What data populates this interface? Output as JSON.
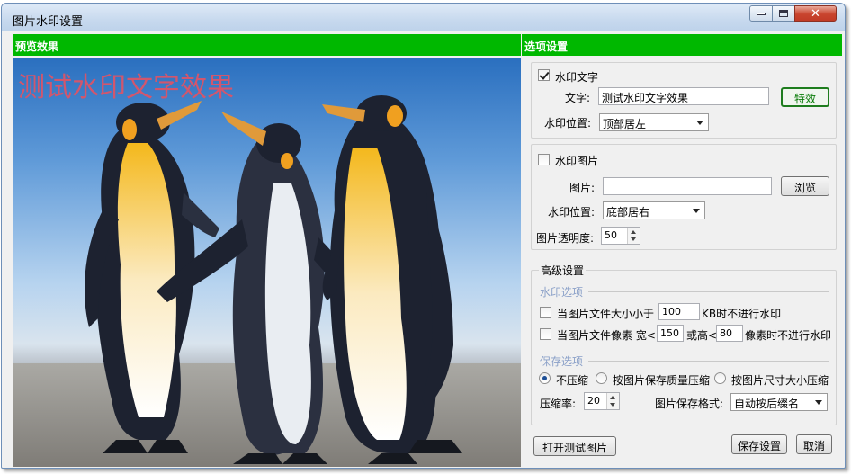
{
  "window": {
    "title": "图片水印设置"
  },
  "preview": {
    "header": "预览效果",
    "watermark_text": "测试水印文字效果"
  },
  "options": {
    "header": "选项设置",
    "text_watermark": {
      "enable_label": "水印文字",
      "checked": true,
      "text_label": "文字:",
      "text_value": "测试水印文字效果",
      "effects_button": "特效",
      "position_label": "水印位置:",
      "position_value": "顶部居左"
    },
    "image_watermark": {
      "enable_label": "水印图片",
      "checked": false,
      "image_label": "图片:",
      "image_value": "",
      "browse_button": "浏览",
      "position_label": "水印位置:",
      "position_value": "底部居右",
      "opacity_label": "图片透明度:",
      "opacity_value": "50"
    },
    "advanced": {
      "title": "高级设置",
      "watermark_options_title": "水印选项",
      "size_rule": {
        "prefix": "当图片文件大小小于",
        "value": "100",
        "suffix": "KB时不进行水印"
      },
      "pixel_rule": {
        "prefix": "当图片文件像素 宽<",
        "width_value": "150",
        "mid": "或高<",
        "height_value": "80",
        "suffix": "像素时不进行水印"
      },
      "save_options_title": "保存选项",
      "compress_options": [
        "不压缩",
        "按图片保存质量压缩",
        "按图片尺寸大小压缩"
      ],
      "compress_selected": 0,
      "ratio_label": "压缩率:",
      "ratio_value": "20",
      "format_label": "图片保存格式:",
      "format_value": "自动按后缀名"
    },
    "buttons": {
      "open_test": "打开测试图片",
      "save": "保存设置",
      "cancel": "取消"
    }
  },
  "colors": {
    "header_green": "#00b800",
    "watermark_pink": "#d2566d"
  }
}
